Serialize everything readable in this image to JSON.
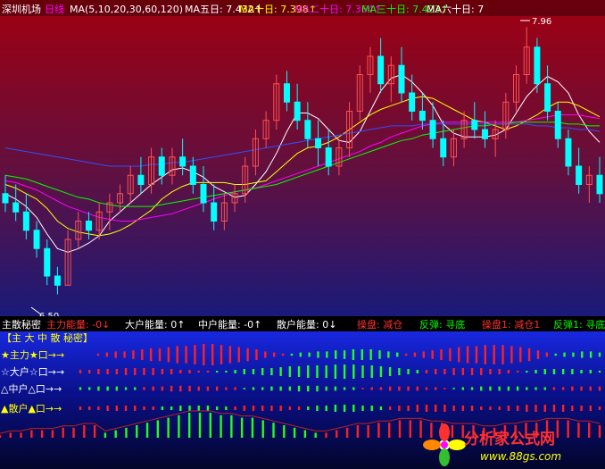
{
  "main_header": {
    "code_label": "深圳机场",
    "period": "日线",
    "ma_params": "MA(5,10,20,30,60,120)",
    "ma_items": [
      {
        "label": "MA五日:",
        "value": "7.432",
        "arrow": "↑",
        "color": "#ffffff"
      },
      {
        "label": "MA十日:",
        "value": "7.398",
        "arrow": "↑",
        "color": "#ffff00"
      },
      {
        "label": "MA二十日:",
        "value": "7.364",
        "arrow": "↑",
        "color": "#ff00ff"
      },
      {
        "label": "MA三十日:",
        "value": "7.423",
        "arrow": "↑",
        "color": "#00ff00"
      },
      {
        "label": "MA六十日:",
        "value": "7",
        "arrow": "",
        "color": "#ffffff"
      }
    ]
  },
  "markers": {
    "high": "7.96",
    "low": "6.50"
  },
  "sub_header": {
    "title": "主散秘密",
    "items": [
      {
        "text": "主力能量: -0↓",
        "color": "#ff3030"
      },
      {
        "text": "大户能量: 0↑",
        "color": "#ffffff"
      },
      {
        "text": "中户能量: -0↑",
        "color": "#ffffff"
      },
      {
        "text": "散户能量: 0↓",
        "color": "#ffffff"
      },
      {
        "text": "操盘: 减仓",
        "color": "#ff3030"
      },
      {
        "text": "反弹: 寻底",
        "color": "#00ff00"
      },
      {
        "text": "操盘1: 减仓1",
        "color": "#ff3030"
      },
      {
        "text": "反弹1: 寻底1",
        "color": "#00ff00"
      }
    ]
  },
  "indicator": {
    "title": "【主 大 中 散 秘密】",
    "rows": [
      {
        "label": "★主力★口→→",
        "color": "#ffff00"
      },
      {
        "label": "☆大户☆口→→",
        "color": "#ffffff"
      },
      {
        "label": "△中户△口→→",
        "color": "#ffffff"
      },
      {
        "label": "▲散户▲口→→",
        "color": "#ffff00"
      }
    ]
  },
  "watermark": {
    "title": "分析家公式网",
    "url": "www.88gs.com"
  },
  "chart_data": {
    "type": "candlestick",
    "ylim": [
      6.4,
      8.0
    ],
    "up_color": "#ff5050",
    "down_color": "#00ffff",
    "candles": [
      [
        7.05,
        7.15,
        6.95,
        7.0
      ],
      [
        7.0,
        7.1,
        6.9,
        6.95
      ],
      [
        6.95,
        7.05,
        6.8,
        6.85
      ],
      [
        6.85,
        6.9,
        6.7,
        6.75
      ],
      [
        6.75,
        6.8,
        6.55,
        6.6
      ],
      [
        6.6,
        6.65,
        6.5,
        6.55
      ],
      [
        6.55,
        6.85,
        6.55,
        6.8
      ],
      [
        6.8,
        6.95,
        6.75,
        6.9
      ],
      [
        6.9,
        6.95,
        6.8,
        6.85
      ],
      [
        6.85,
        7.0,
        6.8,
        6.95
      ],
      [
        6.95,
        7.05,
        6.85,
        7.0
      ],
      [
        7.0,
        7.1,
        6.95,
        7.05
      ],
      [
        7.05,
        7.2,
        7.0,
        7.15
      ],
      [
        7.15,
        7.25,
        7.05,
        7.1
      ],
      [
        7.1,
        7.3,
        7.05,
        7.25
      ],
      [
        7.25,
        7.3,
        7.1,
        7.15
      ],
      [
        7.15,
        7.3,
        7.1,
        7.25
      ],
      [
        7.25,
        7.35,
        7.15,
        7.2
      ],
      [
        7.2,
        7.25,
        7.05,
        7.1
      ],
      [
        7.1,
        7.2,
        6.95,
        7.0
      ],
      [
        7.0,
        7.1,
        6.85,
        6.9
      ],
      [
        6.9,
        7.05,
        6.85,
        7.0
      ],
      [
        7.0,
        7.1,
        6.95,
        7.05
      ],
      [
        7.05,
        7.25,
        7.0,
        7.2
      ],
      [
        7.2,
        7.4,
        7.15,
        7.35
      ],
      [
        7.35,
        7.5,
        7.3,
        7.45
      ],
      [
        7.45,
        7.7,
        7.4,
        7.65
      ],
      [
        7.65,
        7.72,
        7.5,
        7.55
      ],
      [
        7.55,
        7.65,
        7.4,
        7.45
      ],
      [
        7.45,
        7.55,
        7.3,
        7.35
      ],
      [
        7.35,
        7.45,
        7.2,
        7.3
      ],
      [
        7.3,
        7.4,
        7.15,
        7.2
      ],
      [
        7.2,
        7.35,
        7.15,
        7.3
      ],
      [
        7.3,
        7.55,
        7.25,
        7.5
      ],
      [
        7.5,
        7.75,
        7.45,
        7.7
      ],
      [
        7.7,
        7.85,
        7.6,
        7.8
      ],
      [
        7.8,
        7.9,
        7.6,
        7.65
      ],
      [
        7.65,
        7.8,
        7.55,
        7.75
      ],
      [
        7.75,
        7.85,
        7.55,
        7.6
      ],
      [
        7.6,
        7.7,
        7.45,
        7.5
      ],
      [
        7.5,
        7.6,
        7.4,
        7.45
      ],
      [
        7.45,
        7.55,
        7.3,
        7.35
      ],
      [
        7.35,
        7.45,
        7.2,
        7.25
      ],
      [
        7.25,
        7.4,
        7.2,
        7.35
      ],
      [
        7.35,
        7.5,
        7.3,
        7.45
      ],
      [
        7.45,
        7.55,
        7.35,
        7.4
      ],
      [
        7.4,
        7.5,
        7.3,
        7.35
      ],
      [
        7.35,
        7.45,
        7.25,
        7.4
      ],
      [
        7.4,
        7.6,
        7.35,
        7.55
      ],
      [
        7.55,
        7.75,
        7.5,
        7.7
      ],
      [
        7.7,
        7.96,
        7.65,
        7.85
      ],
      [
        7.85,
        7.9,
        7.6,
        7.65
      ],
      [
        7.65,
        7.75,
        7.45,
        7.5
      ],
      [
        7.5,
        7.55,
        7.3,
        7.35
      ],
      [
        7.35,
        7.4,
        7.15,
        7.2
      ],
      [
        7.2,
        7.3,
        7.05,
        7.1
      ],
      [
        7.1,
        7.2,
        7.0,
        7.15
      ],
      [
        7.15,
        7.25,
        7.0,
        7.05
      ]
    ],
    "ma_series": [
      {
        "name": "MA五日",
        "color": "#ffffff",
        "values": [
          7.05,
          7.02,
          6.98,
          6.92,
          6.83,
          6.75,
          6.73,
          6.75,
          6.78,
          6.82,
          6.9,
          6.95,
          7.0,
          7.05,
          7.1,
          7.14,
          7.18,
          7.19,
          7.17,
          7.14,
          7.09,
          7.06,
          7.03,
          7.04,
          7.1,
          7.17,
          7.27,
          7.39,
          7.49,
          7.49,
          7.46,
          7.4,
          7.34,
          7.33,
          7.39,
          7.5,
          7.61,
          7.68,
          7.7,
          7.66,
          7.6,
          7.53,
          7.43,
          7.38,
          7.36,
          7.36,
          7.36,
          7.37,
          7.4,
          7.49,
          7.58,
          7.64,
          7.69,
          7.66,
          7.6,
          7.48,
          7.39,
          7.33
        ]
      },
      {
        "name": "MA十日",
        "color": "#ffff00",
        "values": [
          7.1,
          7.08,
          7.05,
          7.02,
          6.97,
          6.9,
          6.86,
          6.84,
          6.83,
          6.82,
          6.83,
          6.85,
          6.88,
          6.92,
          6.96,
          7.02,
          7.06,
          7.09,
          7.11,
          7.11,
          7.11,
          7.11,
          7.1,
          7.1,
          7.11,
          7.12,
          7.17,
          7.22,
          7.27,
          7.3,
          7.31,
          7.33,
          7.36,
          7.4,
          7.44,
          7.48,
          7.51,
          7.53,
          7.55,
          7.57,
          7.58,
          7.57,
          7.54,
          7.51,
          7.48,
          7.45,
          7.44,
          7.42,
          7.4,
          7.42,
          7.45,
          7.48,
          7.52,
          7.55,
          7.55,
          7.53,
          7.5,
          7.47
        ]
      },
      {
        "name": "MA二十日",
        "color": "#ff00ff",
        "values": [
          7.12,
          7.11,
          7.09,
          7.07,
          7.04,
          7.01,
          6.98,
          6.96,
          6.94,
          6.92,
          6.91,
          6.9,
          6.9,
          6.91,
          6.92,
          6.93,
          6.94,
          6.96,
          6.98,
          7.0,
          7.02,
          7.04,
          7.06,
          7.07,
          7.08,
          7.1,
          7.12,
          7.14,
          7.16,
          7.18,
          7.2,
          7.22,
          7.24,
          7.26,
          7.28,
          7.31,
          7.33,
          7.36,
          7.38,
          7.4,
          7.42,
          7.43,
          7.44,
          7.44,
          7.44,
          7.44,
          7.44,
          7.44,
          7.44,
          7.44,
          7.45,
          7.46,
          7.47,
          7.48,
          7.48,
          7.48,
          7.47,
          7.46
        ]
      },
      {
        "name": "MA三十日",
        "color": "#00ff00",
        "values": [
          7.15,
          7.14,
          7.13,
          7.11,
          7.09,
          7.07,
          7.05,
          7.03,
          7.02,
          7.0,
          6.99,
          6.98,
          6.98,
          6.98,
          6.98,
          6.99,
          7.0,
          7.01,
          7.02,
          7.03,
          7.04,
          7.05,
          7.06,
          7.07,
          7.08,
          7.09,
          7.1,
          7.12,
          7.14,
          7.16,
          7.18,
          7.2,
          7.22,
          7.24,
          7.26,
          7.28,
          7.3,
          7.32,
          7.34,
          7.35,
          7.37,
          7.38,
          7.39,
          7.4,
          7.41,
          7.42,
          7.42,
          7.43,
          7.43,
          7.44,
          7.44,
          7.44,
          7.44,
          7.44,
          7.43,
          7.43,
          7.42,
          7.42
        ]
      },
      {
        "name": "MA六十日",
        "color": "#3050ff",
        "values": [
          7.3,
          7.29,
          7.28,
          7.27,
          7.26,
          7.25,
          7.24,
          7.23,
          7.22,
          7.21,
          7.2,
          7.2,
          7.2,
          7.2,
          7.21,
          7.21,
          7.22,
          7.22,
          7.23,
          7.24,
          7.25,
          7.26,
          7.27,
          7.28,
          7.29,
          7.3,
          7.31,
          7.32,
          7.33,
          7.34,
          7.35,
          7.36,
          7.37,
          7.38,
          7.39,
          7.4,
          7.41,
          7.42,
          7.42,
          7.42,
          7.43,
          7.43,
          7.43,
          7.43,
          7.43,
          7.43,
          7.43,
          7.43,
          7.43,
          7.43,
          7.43,
          7.42,
          7.42,
          7.41,
          7.41,
          7.4,
          7.4,
          7.39
        ]
      }
    ],
    "indicator_rows": [
      {
        "name": "主力",
        "values": [
          0.1,
          0.2,
          0.3,
          0.3,
          0.4,
          0.5,
          0.6,
          0.6,
          0.7,
          0.8,
          0.8,
          0.9,
          1,
          1,
          0.9,
          0.8,
          0.7,
          0.6,
          0.5,
          0.3,
          0.2,
          0.1,
          -0.1,
          -0.2,
          -0.2,
          -0.3,
          -0.3,
          -0.4,
          -0.4,
          -0.5,
          -0.5,
          -0.5,
          -0.4,
          -0.3,
          -0.2,
          0.1,
          0.2,
          0.3,
          0.4,
          0.5,
          0.6,
          0.7,
          0.8,
          0.8,
          0.9,
          0.9,
          0.9,
          0.8,
          0.7,
          0.6,
          0.4,
          0.2,
          -0.1,
          -0.2,
          -0.2,
          -0.3,
          -0.3,
          -0.2
        ]
      },
      {
        "name": "大户",
        "values": [
          0.2,
          0.2,
          0.3,
          0.3,
          0.3,
          0.4,
          0.4,
          0.4,
          0.4,
          0.3,
          0.3,
          0.2,
          0.2,
          0.1,
          0.1,
          -0.1,
          -0.1,
          -0.2,
          -0.3,
          -0.3,
          -0.4,
          -0.4,
          -0.5,
          -0.6,
          -0.6,
          -0.7,
          -0.7,
          -0.7,
          -0.8,
          -0.8,
          -0.8,
          -0.7,
          -0.7,
          -0.6,
          -0.5,
          -0.4,
          -0.3,
          -0.2,
          0.2,
          0.3,
          0.3,
          0.4,
          0.4,
          0.4,
          0.4,
          0.3,
          0.3,
          0.2,
          0.1,
          -0.1,
          -0.2,
          -0.3,
          -0.3,
          -0.3,
          -0.3,
          -0.2,
          -0.2,
          -0.1
        ]
      },
      {
        "name": "中户",
        "values": [
          -0.2,
          -0.2,
          -0.3,
          -0.3,
          -0.3,
          -0.2,
          -0.2,
          0.2,
          0.3,
          0.3,
          0.4,
          0.4,
          0.4,
          0.3,
          0.3,
          0.3,
          0.2,
          0.2,
          -0.1,
          -0.2,
          -0.2,
          -0.3,
          -0.3,
          -0.3,
          -0.4,
          -0.4,
          -0.4,
          -0.3,
          -0.3,
          -0.2,
          -0.2,
          0.1,
          0.2,
          0.2,
          0.3,
          0.3,
          0.3,
          0.3,
          0.2,
          0.2,
          0.1,
          -0.1,
          -0.2,
          -0.2,
          -0.3,
          -0.3,
          -0.3,
          -0.3,
          -0.3,
          -0.2,
          -0.2,
          -0.2,
          0.2,
          0.2,
          0.3,
          0.3,
          0.3,
          0.3
        ]
      },
      {
        "name": "散户",
        "values": [
          0.2,
          0.2,
          0.2,
          0.3,
          0.3,
          0.3,
          0.3,
          0.2,
          0.2,
          -0.2,
          -0.2,
          -0.3,
          -0.3,
          -0.3,
          -0.3,
          -0.2,
          -0.2,
          0.2,
          0.3,
          0.3,
          0.3,
          0.3,
          0.3,
          0.2,
          0.2,
          -0.2,
          -0.3,
          -0.3,
          -0.4,
          -0.4,
          -0.4,
          -0.3,
          -0.3,
          -0.2,
          0.2,
          0.3,
          0.3,
          0.4,
          0.4,
          0.4,
          0.4,
          0.3,
          0.3,
          0.3,
          0.2,
          0.2,
          0.2,
          0.3,
          0.3,
          0.4,
          0.4,
          0.4,
          0.4,
          0.4,
          0.3,
          0.3,
          0.3,
          0.2
        ]
      },
      {
        "name": "合计",
        "values": [
          0.1,
          0.2,
          0.2,
          0.3,
          0.3,
          0.3,
          0.4,
          0.4,
          0.5,
          0.5,
          -0.2,
          -0.3,
          -0.4,
          -0.5,
          -0.6,
          -0.7,
          -0.8,
          -0.9,
          -1,
          -1,
          -1,
          -0.9,
          -0.9,
          -0.8,
          -0.8,
          -0.7,
          -0.6,
          -0.5,
          -0.4,
          -0.3,
          -0.2,
          0.2,
          0.3,
          0.4,
          0.5,
          0.5,
          0.6,
          0.6,
          0.7,
          0.7,
          0.7,
          0.6,
          0.6,
          0.5,
          0.5,
          0.5,
          0.4,
          0.4,
          0.5,
          0.5,
          0.6,
          0.6,
          0.7,
          0.7,
          0.7,
          0.6,
          0.6,
          0.5
        ]
      }
    ]
  }
}
